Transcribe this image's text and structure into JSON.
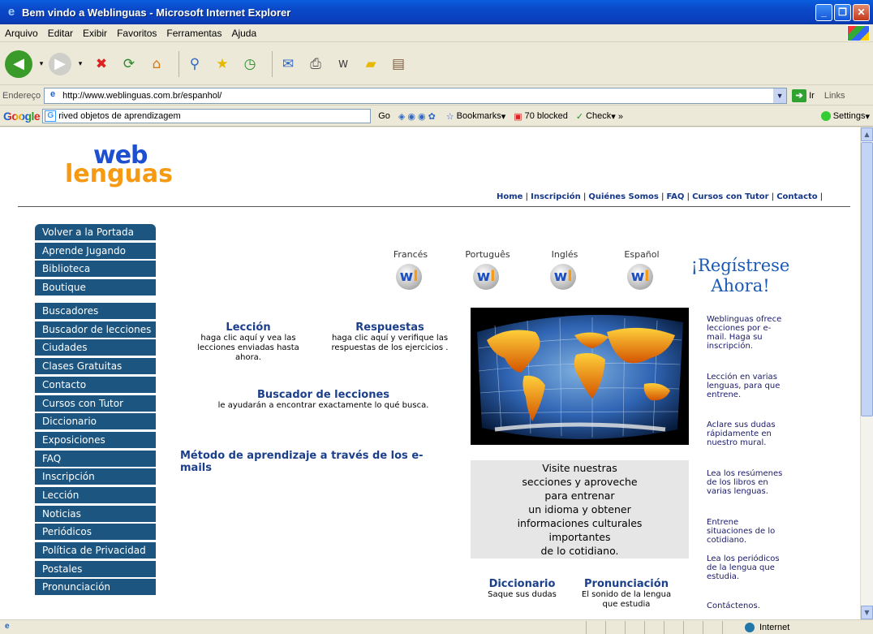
{
  "window": {
    "title": "Bem vindo a Weblinguas - Microsoft Internet Explorer"
  },
  "menu": [
    "Arquivo",
    "Editar",
    "Exibir",
    "Favoritos",
    "Ferramentas",
    "Ajuda"
  ],
  "address": {
    "label": "Endereço",
    "url": "http://www.weblinguas.com.br/espanhol/",
    "go": "Ir",
    "links": "Links"
  },
  "google": {
    "brand": "Google",
    "query": "rived objetos de aprendizagem",
    "go": "Go",
    "bookmarks": "Bookmarks",
    "blocked": "70 blocked",
    "check": "Check",
    "settings": "Settings"
  },
  "status": {
    "zone": "Internet"
  },
  "page": {
    "logo_top": "web",
    "logo_bottom": "lenguas",
    "topnav": [
      "Home",
      "Inscripción",
      "Quiénes Somos",
      "FAQ",
      "Cursos con Tutor",
      "Contacto"
    ],
    "sidenav": [
      "Volver a la Portada",
      "Aprende Jugando",
      "Biblioteca",
      "Boutique",
      "Buscadores",
      "Buscador de lecciones",
      "Ciudades",
      "Clases Gratuitas",
      "Contacto",
      "Cursos con Tutor",
      "Diccionario",
      "Exposiciones",
      "FAQ",
      "Inscripción",
      "Lección",
      "Noticias",
      "Periódicos",
      "Política de Privacidad",
      "Postales",
      "Pronunciación"
    ],
    "badges": [
      "Francés",
      "Português",
      "Inglés",
      "Español"
    ],
    "register": {
      "line1": "¡Regístrese",
      "line2": "Ahora!"
    },
    "leccion": {
      "title": "Lección",
      "desc": "haga clic aquí y vea las lecciones enviadas hasta ahora."
    },
    "respuestas": {
      "title": "Respuestas",
      "desc": "haga clic aquí y verifique las respuestas de los ejercicios ."
    },
    "buscador": {
      "title": "Buscador de lecciones",
      "desc": "le ayudarán a encontrar exactamente lo qué busca."
    },
    "metodo": "Método de aprendizaje a través de los e-mails",
    "visit": [
      "Visite nuestras",
      "secciones y aproveche",
      "para entrenar",
      "un idioma y obtener",
      "informaciones culturales",
      "importantes",
      "de lo cotidiano."
    ],
    "diccionario": {
      "title": "Diccionario",
      "desc": "Saque sus dudas"
    },
    "pronunciacion": {
      "title": "Pronunciación",
      "desc": "El sonido de la lengua que estudia"
    },
    "right": [
      "Weblinguas ofrece lecciones por e-mail. Haga su inscripción.",
      "Lección en varias lenguas, para que entrene.",
      "Aclare sus dudas rápidamente en nuestro mural.",
      "Lea los resúmenes de los libros en varias lenguas.",
      "Entrene situaciones de lo cotidiano.",
      "Lea los periódicos de la lengua que estudia.",
      "Contáctenos."
    ]
  },
  "colors": {
    "nav_bg": "#1b5580",
    "logo_blue": "#1d4fd0",
    "logo_orange": "#f59a12",
    "link_blue": "#1b3f8b"
  }
}
